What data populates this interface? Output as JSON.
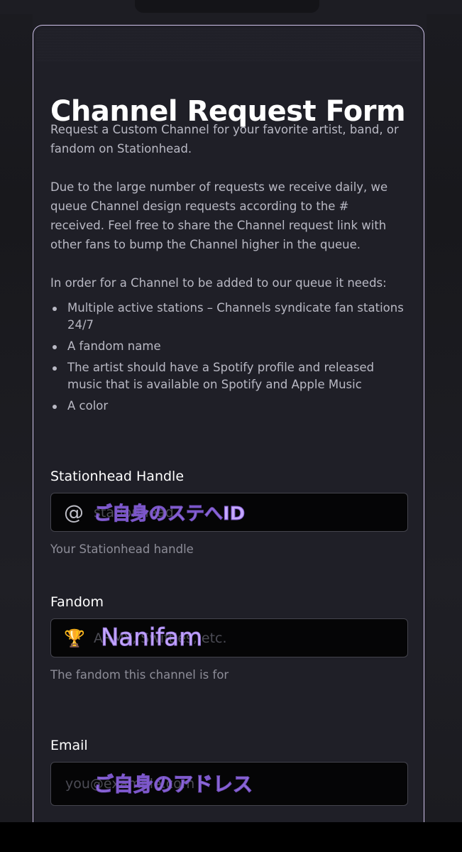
{
  "form": {
    "title": "Channel Request Form",
    "intro": "Request a Custom Channel for your favorite artist, band, or fandom on Stationhead.",
    "queue_note": "Due to the large number of requests we receive daily, we queue Channel design requests according to the # received. Feel free to share the Channel request link with other fans to bump the Channel higher in the queue.",
    "requirements_heading": "In order for a Channel to be added to our queue it needs:",
    "requirements": [
      "Multiple active stations – Channels syndicate fan stations 24/7",
      "A fandom name",
      "The artist should have a Spotify profile and released music that is available on Spotify and Apple Music",
      "A color"
    ]
  },
  "fields": {
    "handle": {
      "label": "Stationhead Handle",
      "icon": "at-sign-icon",
      "icon_glyph": "@",
      "placeholder": "stationhead",
      "overlay_text": "ご自身のステへID",
      "helper": "Your Stationhead handle"
    },
    "fandom": {
      "label": "Fandom",
      "icon": "trophy-icon",
      "icon_glyph": "🏆",
      "placeholder": "ARMY, Swifties, etc.",
      "overlay_text": "Nanifam",
      "helper": "The fandom this channel is for"
    },
    "email": {
      "label": "Email",
      "placeholder": "you@example.com",
      "overlay_text": "ご自身のアドレス"
    }
  },
  "colors": {
    "background": "#1d1d23",
    "card": "#1f1f27",
    "card_border": "#cfc3ea",
    "title": "#ffffff",
    "body_text": "#b9b9c4",
    "helper_text": "#8d8d98",
    "input_bg": "#050506",
    "annotation_purple": "#c6a9ff"
  }
}
